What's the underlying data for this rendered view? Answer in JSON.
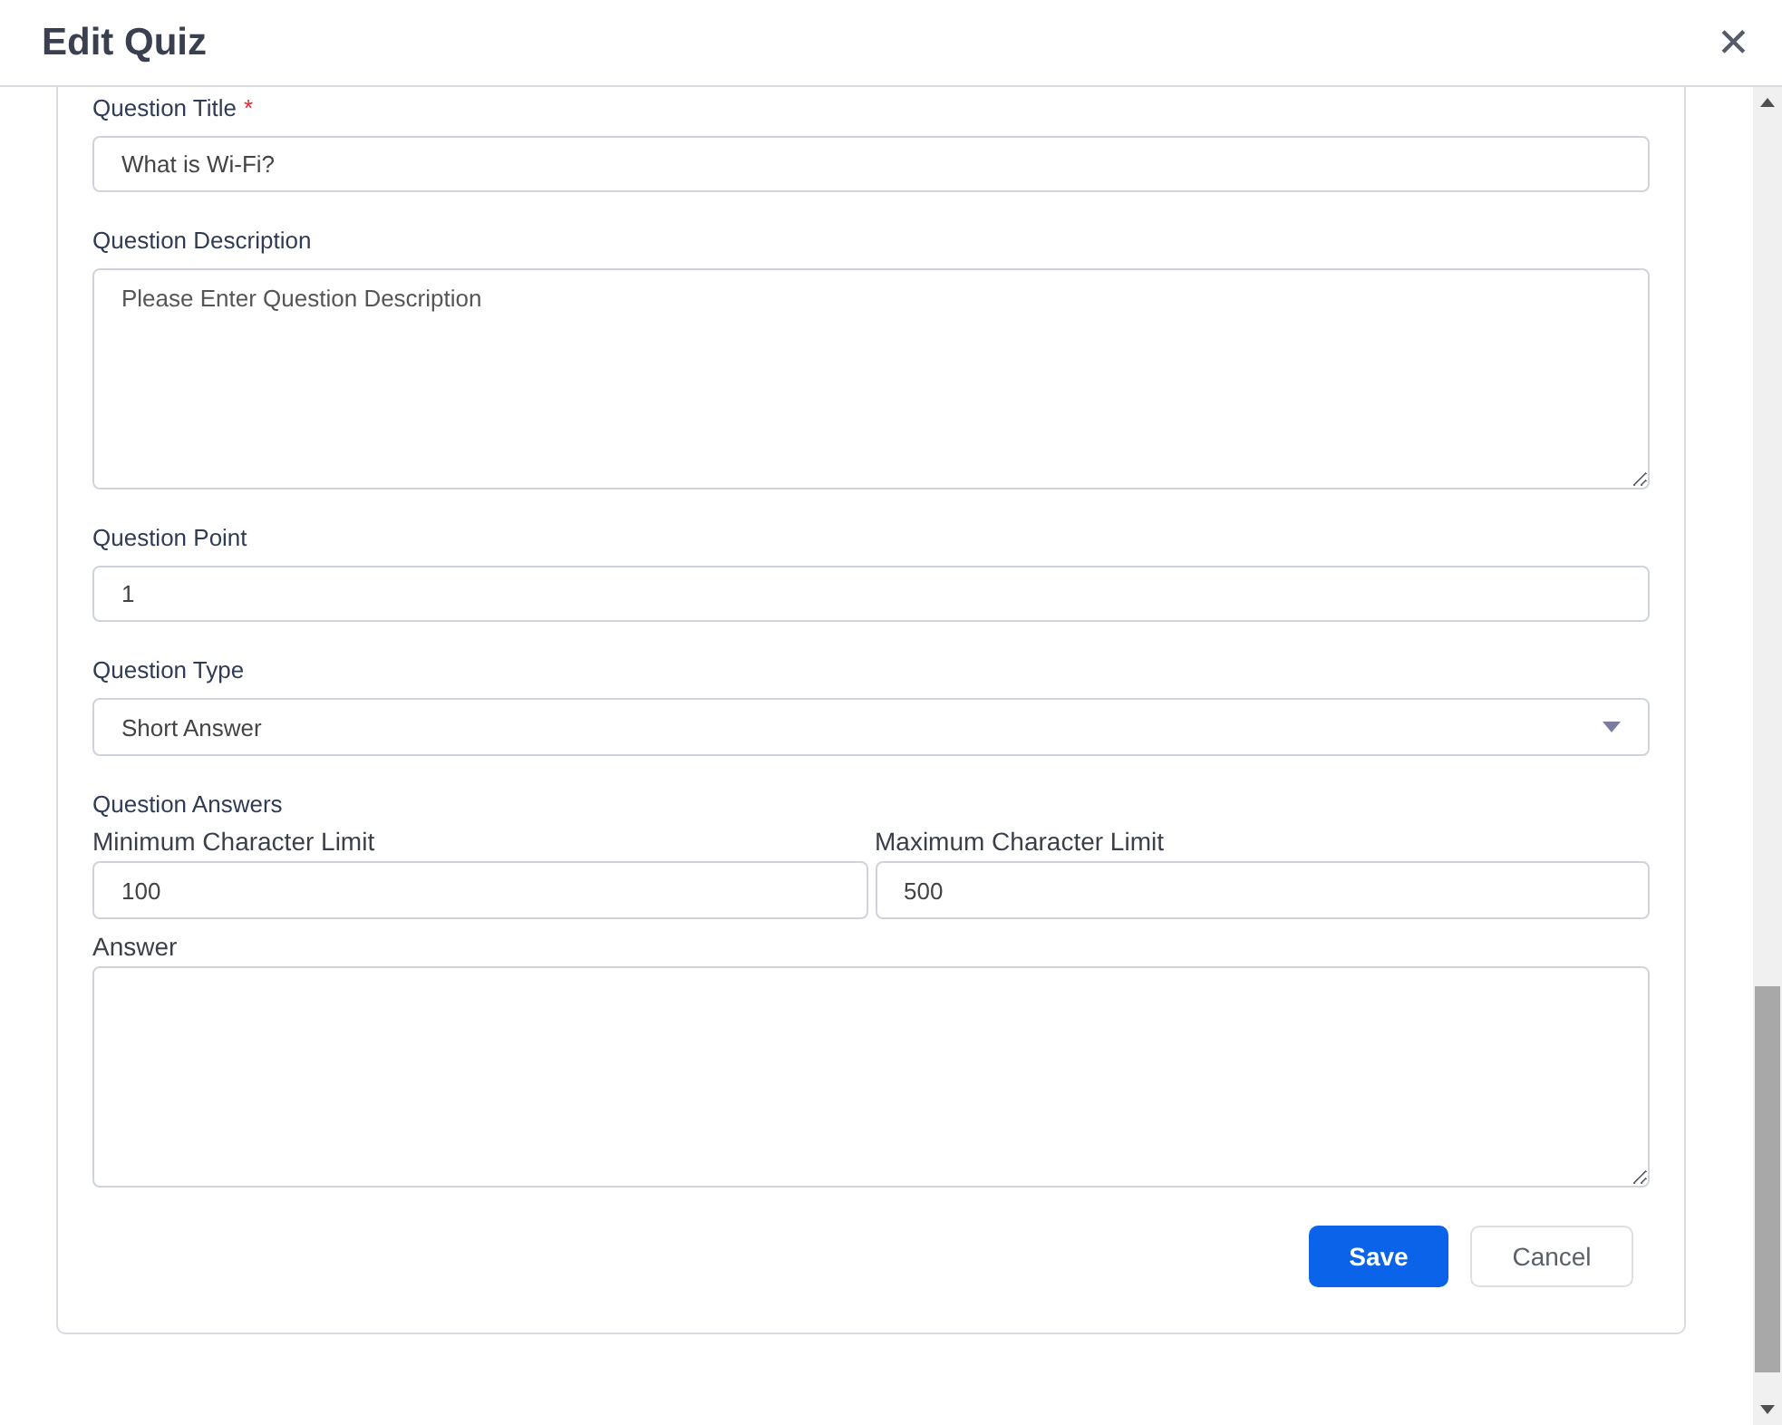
{
  "dialog": {
    "title": "Edit Quiz",
    "close": "✕"
  },
  "fields": [
    {
      "kind": "input",
      "label": "Question Title",
      "required_mark": "*",
      "value": "What is Wi-Fi?"
    },
    {
      "kind": "textarea",
      "label": "Question Description",
      "placeholder": "Please Enter Question Description"
    },
    {
      "kind": "input",
      "label": "Question Point",
      "value": "1"
    },
    {
      "kind": "select",
      "label": "Question Type",
      "value": "Short Answer"
    }
  ],
  "answers": {
    "label": "Question Answers",
    "limits": [
      {
        "label": "Minimum Character Limit",
        "value": "100"
      },
      {
        "label": "Maximum Character Limit",
        "value": "500"
      }
    ],
    "answer": {
      "label": "Answer"
    }
  },
  "buttons": [
    {
      "label": "Save",
      "kind": "primary"
    },
    {
      "label": "Cancel",
      "kind": "secondary"
    }
  ]
}
